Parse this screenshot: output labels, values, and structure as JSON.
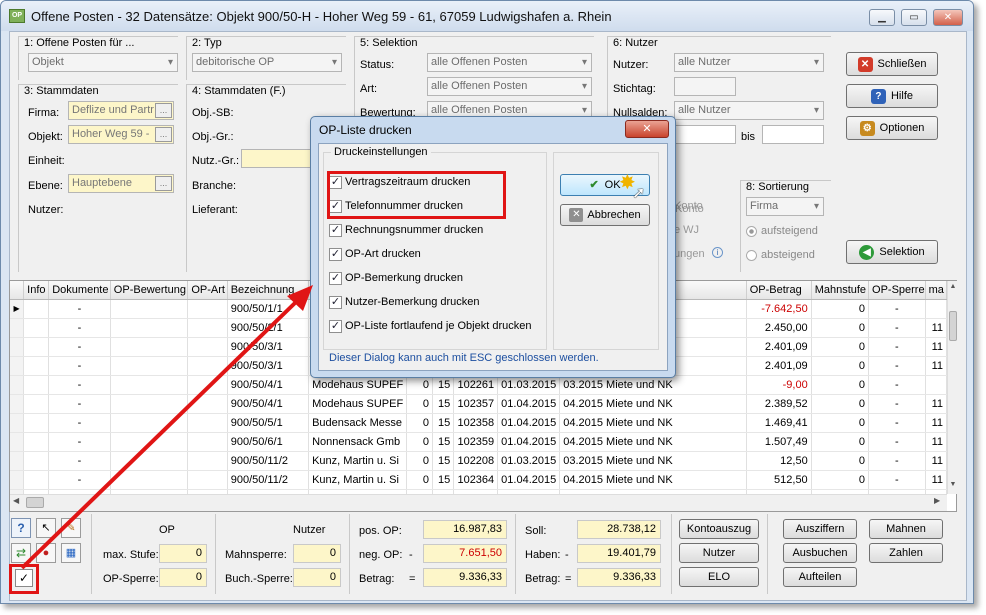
{
  "window": {
    "title": "Offene Posten - 32 Datensätze: Objekt 900/50-H - Hoher Weg 59 - 61, 67059 Ludwigshafen a. Rhein",
    "minimize": "▁",
    "maximize": "▭",
    "close": "✕"
  },
  "filters": {
    "g1": {
      "label": "1: Offene Posten für ...",
      "value": "Objekt"
    },
    "g2": {
      "label": "2: Typ",
      "value": "debitorische OP"
    },
    "g3": {
      "label": "3: Stammdaten",
      "firma_label": "Firma:",
      "firma_value": "Deflize und Partr",
      "objekt_label": "Objekt:",
      "objekt_value": "Hoher Weg 59 -",
      "einheit_label": "Einheit:",
      "ebene_label": "Ebene:",
      "ebene_value": "Hauptebene",
      "nutzer_label": "Nutzer:"
    },
    "g4": {
      "label": "4: Stammdaten (F.)",
      "objsb": "Obj.-SB:",
      "objgr": "Obj.-Gr.:",
      "nutzgr": "Nutz.-Gr.:",
      "branche": "Branche:",
      "lieferant": "Lieferant:"
    },
    "g5": {
      "label": "5: Selektion",
      "status_label": "Status:",
      "status_value": "alle Offenen Posten",
      "art_label": "Art:",
      "art_value": "alle Offenen Posten",
      "bewertung_label": "Bewertung:",
      "bewertung_value": "alle Offenen Posten"
    },
    "g6": {
      "label": "6: Nutzer",
      "nutzer_label": "Nutzer:",
      "nutzer_value": "alle Nutzer",
      "stichtag_label": "Stichtag:",
      "nullsalden_label": "Nullsalden:",
      "nullsalden_value": "alle Nutzer",
      "bis_label": "bis"
    },
    "g8": {
      "label": "8: Sortierung",
      "value": "Firma",
      "opt1": "aufsteigend",
      "opt2": "absteigend"
    },
    "partial": {
      "konto": "Konto",
      "wj": "e WJ",
      "ungen": "ungen"
    }
  },
  "side_buttons": {
    "close": "Schließen",
    "help": "Hilfe",
    "options": "Optionen",
    "selection": "Selektion"
  },
  "grid": {
    "columns": [
      "Info",
      "Dokumente",
      "OP-Bewertung",
      "OP-Art",
      "Bezeichnung",
      "OP-Betrag",
      "Mahnstufe",
      "OP-Sperre",
      "ma"
    ],
    "rows": [
      {
        "dok": "-",
        "bez": "900/50/1/1",
        "nutzer": "",
        "a": "",
        "b": "",
        "nr": "",
        "d1": "",
        "text": "K",
        "betrag": "-7.642,50",
        "neg": true,
        "mahn": "0",
        "sperre": "-",
        "ma": ""
      },
      {
        "dok": "-",
        "bez": "900/50/2/1",
        "nutzer": "",
        "a": "",
        "b": "",
        "nr": "",
        "d1": "",
        "text": "NK",
        "betrag": "2.450,00",
        "neg": false,
        "mahn": "0",
        "sperre": "-",
        "ma": "11"
      },
      {
        "dok": "-",
        "bez": "900/50/3/1",
        "nutzer": "",
        "a": "",
        "b": "",
        "nr": "",
        "d1": "",
        "text": "NK",
        "betrag": "2.401,09",
        "neg": false,
        "mahn": "0",
        "sperre": "-",
        "ma": "11"
      },
      {
        "dok": "-",
        "bez": "900/50/3/1",
        "nutzer": "",
        "a": "",
        "b": "",
        "nr": "",
        "d1": "",
        "text": "NK",
        "betrag": "2.401,09",
        "neg": false,
        "mahn": "0",
        "sperre": "-",
        "ma": "11"
      },
      {
        "dok": "-",
        "bez": "900/50/4/1",
        "nutzer": "Modehaus SUPEF",
        "a": "0",
        "b": "15",
        "nr": "102261",
        "d1": "01.03.2015",
        "text": "03.2015 Miete und NK",
        "betrag": "-9,00",
        "neg": true,
        "mahn": "0",
        "sperre": "-",
        "ma": ""
      },
      {
        "dok": "-",
        "bez": "900/50/4/1",
        "nutzer": "Modehaus SUPEF",
        "a": "0",
        "b": "15",
        "nr": "102357",
        "d1": "01.04.2015",
        "text": "04.2015 Miete und NK",
        "betrag": "2.389,52",
        "neg": false,
        "mahn": "0",
        "sperre": "-",
        "ma": "11"
      },
      {
        "dok": "-",
        "bez": "900/50/5/1",
        "nutzer": "Budensack Messe",
        "a": "0",
        "b": "15",
        "nr": "102358",
        "d1": "01.04.2015",
        "text": "04.2015 Miete und NK",
        "betrag": "1.469,41",
        "neg": false,
        "mahn": "0",
        "sperre": "-",
        "ma": "11"
      },
      {
        "dok": "-",
        "bez": "900/50/6/1",
        "nutzer": "Nonnensack Gmb",
        "a": "0",
        "b": "15",
        "nr": "102359",
        "d1": "01.04.2015",
        "text": "04.2015 Miete und NK",
        "betrag": "1.507,49",
        "neg": false,
        "mahn": "0",
        "sperre": "-",
        "ma": "11"
      },
      {
        "dok": "-",
        "bez": "900/50/11/2",
        "nutzer": "Kunz, Martin u. Si",
        "a": "0",
        "b": "15",
        "nr": "102208",
        "d1": "01.03.2015",
        "text": "03.2015 Miete und NK",
        "betrag": "12,50",
        "neg": false,
        "mahn": "0",
        "sperre": "-",
        "ma": "11"
      },
      {
        "dok": "-",
        "bez": "900/50/11/2",
        "nutzer": "Kunz, Martin u. Si",
        "a": "0",
        "b": "15",
        "nr": "102364",
        "d1": "01.04.2015",
        "text": "04.2015 Miete und NK",
        "betrag": "512,50",
        "neg": false,
        "mahn": "0",
        "sperre": "-",
        "ma": "11"
      },
      {
        "dok": "-",
        "bez": "900/50/13/3",
        "nutzer": "Trautwein, H. u. T",
        "a": "0",
        "b": "14",
        "nr": "101763",
        "d1": "01.12.2014",
        "text": "12.2014 Miete und NK",
        "betrag": "165,03",
        "neg": false,
        "mahn": "0",
        "sperre": "-",
        "ma": "11"
      }
    ]
  },
  "summary": {
    "op_label": "OP",
    "max_stufe_label": "max. Stufe:",
    "max_stufe": "0",
    "op_sperre_label": "OP-Sperre:",
    "op_sperre": "0",
    "nutzer_label": "Nutzer",
    "mahnsperre_label": "Mahnsperre:",
    "mahnsperre": "0",
    "buchsperre_label": "Buch.-Sperre:",
    "buchsperre": "0",
    "pos_op_label": "pos. OP:",
    "pos_op": "16.987,83",
    "neg_op_label": "neg. OP:",
    "neg_op_sign": "-",
    "neg_op": "7.651,50",
    "betrag_label": "Betrag:",
    "betrag_sign": "=",
    "betrag": "9.336,33",
    "soll_label": "Soll:",
    "soll": "28.738,12",
    "haben_label": "Haben:",
    "haben_sign": "-",
    "haben": "19.401,79",
    "betrag2_label": "Betrag:",
    "betrag2_sign": "=",
    "betrag2": "9.336,33"
  },
  "action_buttons": {
    "kontoauszug": "Kontoauszug",
    "nutzer": "Nutzer",
    "elo": "ELO",
    "ausziffern": "Ausziffern",
    "ausbuchen": "Ausbuchen",
    "aufteilen": "Aufteilen",
    "mahnen": "Mahnen",
    "zahlen": "Zahlen"
  },
  "dialog": {
    "title": "OP-Liste drucken",
    "group_label": "Druckeinstellungen",
    "options": [
      "Vertragszeitraum drucken",
      "Telefonnummer drucken",
      "Rechnungsnummer drucken",
      "OP-Art drucken",
      "OP-Bemerkung drucken",
      "Nutzer-Bemerkung drucken",
      "OP-Liste fortlaufend je Objekt drucken"
    ],
    "ok": "OK",
    "cancel": "Abbrechen",
    "hint": "Dieser Dialog kann auch mit ESC geschlossen werden.",
    "close": "✕"
  }
}
